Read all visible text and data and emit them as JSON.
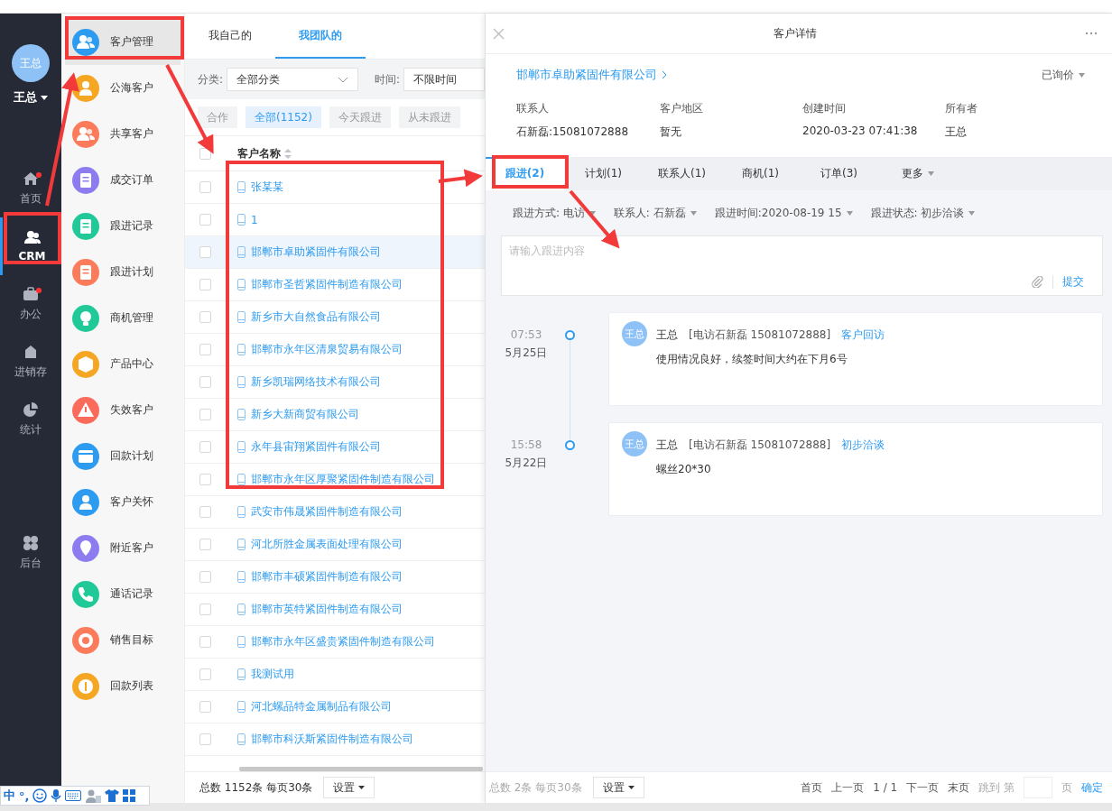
{
  "nav": {
    "avatar": "王总",
    "user": "王总",
    "items": [
      {
        "label": "首页",
        "kind": "home",
        "selected": false,
        "badge": true
      },
      {
        "label": "CRM",
        "kind": "crm",
        "selected": true,
        "badge": false
      },
      {
        "label": "办公",
        "kind": "office",
        "selected": false,
        "badge": true
      },
      {
        "label": "进销存",
        "kind": "inventory",
        "selected": false,
        "badge": false
      },
      {
        "label": "统计",
        "kind": "stats",
        "selected": false,
        "badge": false
      },
      {
        "label": "后台",
        "kind": "admin",
        "selected": false,
        "badge": false
      }
    ]
  },
  "modules": [
    {
      "label": "客户管理",
      "kind": "people",
      "color": "#2d9bf0",
      "selected": true
    },
    {
      "label": "公海客户",
      "kind": "person",
      "color": "#f5a623",
      "selected": false
    },
    {
      "label": "共享客户",
      "kind": "people",
      "color": "#fb7b5b",
      "selected": false
    },
    {
      "label": "成交订单",
      "kind": "doc",
      "color": "#8c7cf0",
      "selected": false
    },
    {
      "label": "跟进记录",
      "kind": "doc",
      "color": "#20c997",
      "selected": false
    },
    {
      "label": "跟进计划",
      "kind": "doc",
      "color": "#fb7b5b",
      "selected": false
    },
    {
      "label": "商机管理",
      "kind": "bulb",
      "color": "#20c997",
      "selected": false
    },
    {
      "label": "产品中心",
      "kind": "box",
      "color": "#f5a623",
      "selected": false
    },
    {
      "label": "失效客户",
      "kind": "warn",
      "color": "#fb6b5b",
      "selected": false
    },
    {
      "label": "回款计划",
      "kind": "card",
      "color": "#2d9bf0",
      "selected": false
    },
    {
      "label": "客户关怀",
      "kind": "person",
      "color": "#2d9bf0",
      "selected": false
    },
    {
      "label": "附近客户",
      "kind": "pin",
      "color": "#8c7cf0",
      "selected": false
    },
    {
      "label": "通话记录",
      "kind": "phone",
      "color": "#20c997",
      "selected": false
    },
    {
      "label": "销售目标",
      "kind": "target",
      "color": "#fb7b5b",
      "selected": false
    },
    {
      "label": "回款列表",
      "kind": "coin",
      "color": "#f5a623",
      "selected": false
    }
  ],
  "list": {
    "tabs": [
      {
        "label": "我自己的",
        "selected": false
      },
      {
        "label": "我团队的",
        "selected": true
      }
    ],
    "filters": {
      "category_label": "分类:",
      "category": "全部分类",
      "time_label": "时间:",
      "time": "不限时间"
    },
    "chips": [
      {
        "label": "合作",
        "selected": false
      },
      {
        "label": "全部(1152)",
        "selected": true
      },
      {
        "label": "今天跟进",
        "selected": false
      },
      {
        "label": "从未跟进",
        "selected": false
      }
    ],
    "column": "客户名称",
    "all_checked": false,
    "rows": [
      {
        "name": "张某某",
        "selected": false,
        "checked": false
      },
      {
        "name": "1",
        "selected": false,
        "checked": false
      },
      {
        "name": "邯郸市卓助紧固件有限公司",
        "selected": true,
        "checked": false
      },
      {
        "name": "邯郸市圣哲紧固件制造有限公司",
        "selected": false,
        "checked": false
      },
      {
        "name": "新乡市大自然食品有限公司",
        "selected": false,
        "checked": false
      },
      {
        "name": "邯郸市永年区清泉贸易有限公司",
        "selected": false,
        "checked": false
      },
      {
        "name": "新乡凯瑞网络技术有限公司",
        "selected": false,
        "checked": false
      },
      {
        "name": "新乡大新商贸有限公司",
        "selected": false,
        "checked": false
      },
      {
        "name": "永年县宙翔紧固件有限公司",
        "selected": false,
        "checked": false
      },
      {
        "name": "邯郸市永年区厚聚紧固件制造有限公司",
        "selected": false,
        "checked": false
      },
      {
        "name": "武安市伟晟紧固件制造有限公司",
        "selected": false,
        "checked": false
      },
      {
        "name": "河北所胜金属表面处理有限公司",
        "selected": false,
        "checked": false
      },
      {
        "name": "邯郸市丰硕紧固件制造有限公司",
        "selected": false,
        "checked": false
      },
      {
        "name": "邯郸市英特紧固件制造有限公司",
        "selected": false,
        "checked": false
      },
      {
        "name": "邯郸市永年区盛贵紧固件制造有限公司",
        "selected": false,
        "checked": false
      },
      {
        "name": "我测试用",
        "selected": false,
        "checked": false
      },
      {
        "name": "河北螺品特金属制品有限公司",
        "selected": false,
        "checked": false
      },
      {
        "name": "邯郸市科沃斯紧固件制造有限公司",
        "selected": false,
        "checked": false
      }
    ],
    "footer": {
      "total": "总数 1152条 每页30条",
      "settings": "设置"
    }
  },
  "detail": {
    "title": "客户详情",
    "company": "邯郸市卓助紧固件有限公司",
    "status": "已询价",
    "info": [
      {
        "label": "联系人",
        "value": "石新磊:15081072888"
      },
      {
        "label": "客户地区",
        "value": "暂无"
      },
      {
        "label": "创建时间",
        "value": "2020-03-23 07:41:38"
      },
      {
        "label": "所有者",
        "value": "王总"
      }
    ],
    "tabs": [
      {
        "label": "跟进(2)",
        "selected": true,
        "dropdown": false
      },
      {
        "label": "计划(1)",
        "selected": false,
        "dropdown": false
      },
      {
        "label": "联系人(1)",
        "selected": false,
        "dropdown": false
      },
      {
        "label": "商机(1)",
        "selected": false,
        "dropdown": false
      },
      {
        "label": "订单(3)",
        "selected": false,
        "dropdown": false
      },
      {
        "label": "更多",
        "selected": false,
        "dropdown": true
      }
    ],
    "selectors": [
      "跟进方式: 电访",
      "联系人: 石新磊",
      "跟进时间:2020-08-19 15",
      "跟进状态: 初步洽谈"
    ],
    "input": {
      "placeholder": "请输入跟进内容",
      "submit": "提交"
    },
    "records": [
      {
        "time": "07:53",
        "date": "5月25日",
        "avatar": "王总",
        "author": "王总",
        "contact": "[电访石新磊 15081072888]",
        "status": "客户回访",
        "content": "使用情况良好，续签时间大约在下月6号"
      },
      {
        "time": "15:58",
        "date": "5月22日",
        "avatar": "王总",
        "author": "王总",
        "contact": "[电访石新磊 15081072888]",
        "status": "初步洽谈",
        "content": "螺丝20*30"
      }
    ],
    "footer": {
      "total": "总数 2条 每页30条",
      "settings": "设置",
      "first": "首页",
      "prev": "上一页",
      "pages": "1 / 1",
      "next": "下一页",
      "last": "末页",
      "jump": "跳到 第",
      "page_unit": "页",
      "confirm": "确定"
    }
  },
  "ime": {
    "mode": "中",
    "punct": "°,"
  }
}
